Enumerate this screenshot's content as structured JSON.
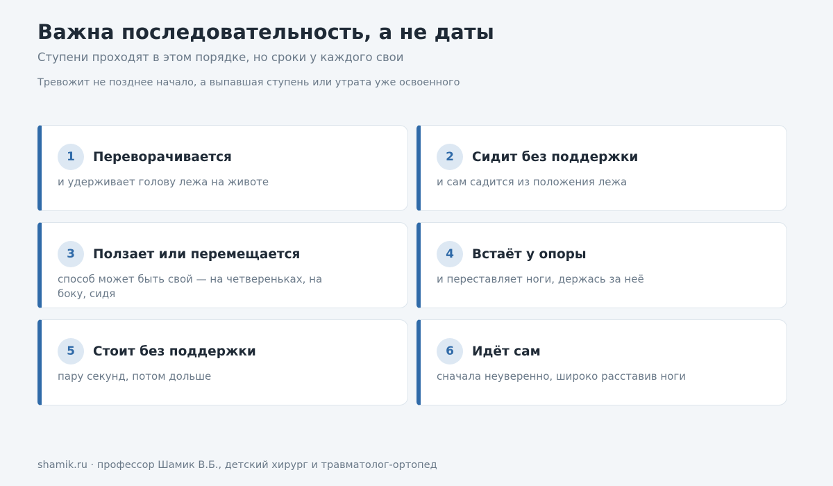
{
  "header": {
    "title": "Важна последовательность, а не даты",
    "subtitle": "Ступени проходят в этом порядке, но сроки у каждого свои",
    "note": "Тревожит не позднее начало, а выпавшая ступень или утрата уже освоенного"
  },
  "steps": [
    {
      "number": "1",
      "title": "Переворачивается",
      "description": "и удерживает голову лежа на животе"
    },
    {
      "number": "2",
      "title": "Сидит без поддержки",
      "description": "и сам садится из положения лежа"
    },
    {
      "number": "3",
      "title": "Ползает или перемещается",
      "description": "способ может быть свой — на четвереньках, на боку, сидя"
    },
    {
      "number": "4",
      "title": "Встаёт у опоры",
      "description": "и переставляет ноги, держась за неё"
    },
    {
      "number": "5",
      "title": "Стоит без поддержки",
      "description": "пару секунд, потом дольше"
    },
    {
      "number": "6",
      "title": "Идёт сам",
      "description": "сначала неуверенно, широко расставив ноги"
    }
  ],
  "footer": {
    "text": "shamik.ru · профессор Шамик В.Б., детский хирург и травматолог-ортопед"
  },
  "colors": {
    "accent": "#2f6aa8",
    "background": "#f3f6f9",
    "card": "#ffffff",
    "badge": "#dde8f3"
  }
}
